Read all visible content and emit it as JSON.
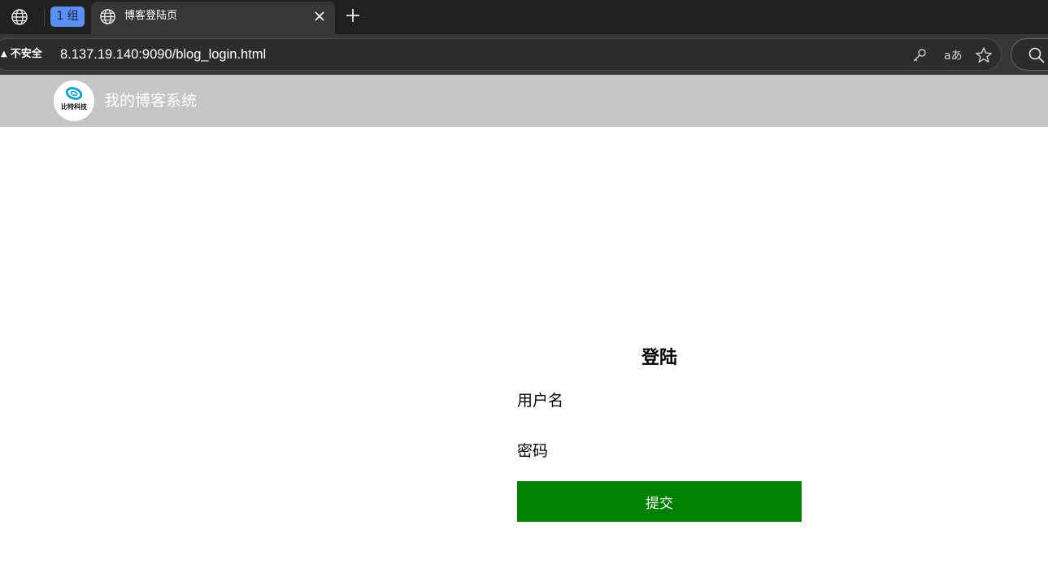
{
  "browser": {
    "group_chip": "1 组",
    "tab_title": "博客登陆页",
    "insecure_label": "不安全",
    "url": "8.137.19.140:9090/blog_login.html",
    "icons": {
      "globe": "globe-icon",
      "close": "close-icon",
      "new_tab": "plus-icon",
      "key": "key-icon",
      "read_aloud": "read-aloud-icon",
      "favorite": "star-icon",
      "search": "search-icon"
    }
  },
  "nav": {
    "logo_text": "比特科技",
    "title": "我的博客系统"
  },
  "login": {
    "title": "登陆",
    "username_label": "用户名",
    "password_label": "密码",
    "submit_label": "提交"
  },
  "colors": {
    "nav_bg": "#c5c5c5",
    "submit_bg": "#008000",
    "chrome_dark": "#202020",
    "chrome_tab": "#373737",
    "group_chip": "#5b8ff0"
  }
}
